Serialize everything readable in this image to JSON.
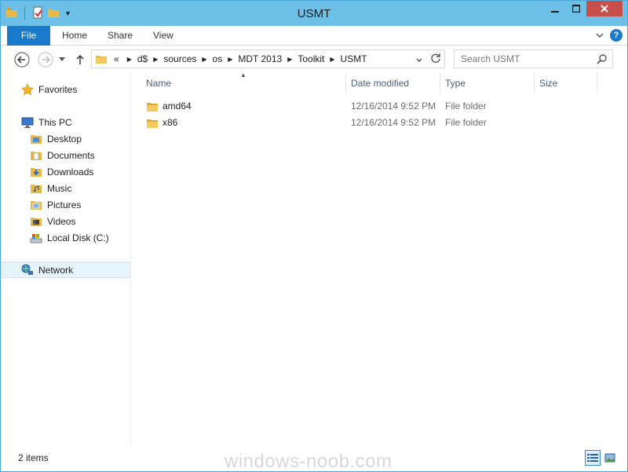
{
  "window": {
    "title": "USMT"
  },
  "ribbon": {
    "tabs": [
      {
        "label": "File"
      },
      {
        "label": "Home"
      },
      {
        "label": "Share"
      },
      {
        "label": "View"
      }
    ]
  },
  "address": {
    "overflow": "«",
    "crumbs": [
      "d$",
      "sources",
      "os",
      "MDT 2013",
      "Toolkit",
      "USMT"
    ]
  },
  "search": {
    "placeholder": "Search USMT"
  },
  "navpane": {
    "favorites": "Favorites",
    "this_pc": "This PC",
    "pc_items": [
      "Desktop",
      "Documents",
      "Downloads",
      "Music",
      "Pictures",
      "Videos",
      "Local Disk (C:)"
    ],
    "network": "Network"
  },
  "columns": {
    "name": "Name",
    "date": "Date modified",
    "type": "Type",
    "size": "Size"
  },
  "files": [
    {
      "name": "amd64",
      "date": "12/16/2014 9:52 PM",
      "type": "File folder",
      "size": ""
    },
    {
      "name": "x86",
      "date": "12/16/2014 9:52 PM",
      "type": "File folder",
      "size": ""
    }
  ],
  "status": {
    "count": "2 items"
  },
  "watermark": "windows-noob.com",
  "colors": {
    "titlebar": "#6cc0e8",
    "accent": "#1979ca",
    "folder": "#e8b948"
  }
}
